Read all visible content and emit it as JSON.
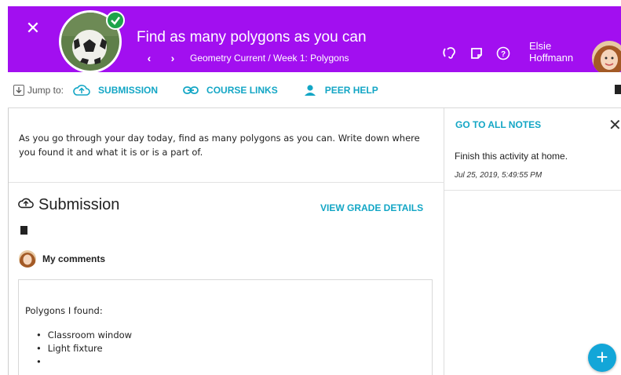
{
  "header": {
    "title": "Find as many polygons as you can",
    "breadcrumb": "Geometry Current / Week 1: Polygons",
    "user_first": "Elsie",
    "user_last": "Hoffmann",
    "icons": [
      "close-icon",
      "hearing-icon",
      "note-icon",
      "help-icon"
    ],
    "background": "#a20ff0"
  },
  "toolbar": {
    "jump_label": "Jump to:",
    "links": [
      {
        "label": "SUBMISSION",
        "icon": "cloud-upload-icon"
      },
      {
        "label": "COURSE LINKS",
        "icon": "link-icon"
      },
      {
        "label": "PEER HELP",
        "icon": "person-icon"
      }
    ]
  },
  "main": {
    "description": "As you go through your day today, find as many polygons as you can. Write down where you found it and what it is or is a part of.",
    "submission_title": "Submission",
    "view_grade": "VIEW GRADE DETAILS",
    "comments_label": "My comments",
    "comment": {
      "heading": "Polygons I found:",
      "items": [
        "Classroom window",
        "Light fixture",
        ""
      ]
    }
  },
  "notes": {
    "go_all": "GO TO ALL NOTES",
    "text": "Finish this activity at home.",
    "date": "Jul 25, 2019, 5:49:55 PM"
  },
  "colors": {
    "accent": "#13a6c5",
    "fab": "#13a6d8",
    "badge": "#1ea34a"
  }
}
